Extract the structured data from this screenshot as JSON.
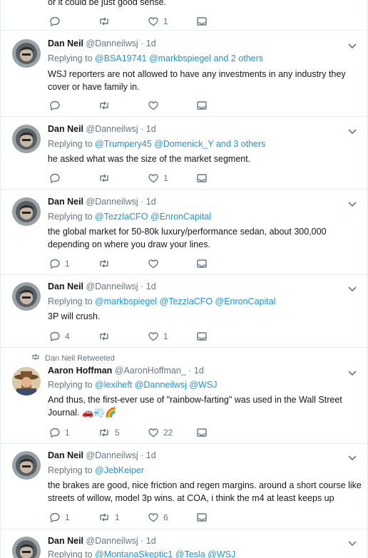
{
  "top_partial": {
    "text": "or it could be just good sense.",
    "like_count": "1"
  },
  "retweet_banner": "Dan Neil Retweeted",
  "tweets": [
    {
      "name": "Dan Neil",
      "handle": "@Danneilwsj",
      "time": "1d",
      "replying_prefix": "Replying to",
      "replying_mentions": "@BSA19741 @markbspiegel",
      "replying_suffix": "and 2 others",
      "text": "WSJ reporters are not allowed to have any investments in any industry they cover or have family in.",
      "reply_count": "",
      "retweet_count": "",
      "like_count": ""
    },
    {
      "name": "Dan Neil",
      "handle": "@Danneilwsj",
      "time": "1d",
      "replying_prefix": "Replying to",
      "replying_mentions": "@Trumpery45 @Domenick_Y",
      "replying_suffix": "and 3 others",
      "text": "he asked what was the size of the market segment.",
      "reply_count": "",
      "retweet_count": "",
      "like_count": "1"
    },
    {
      "name": "Dan Neil",
      "handle": "@Danneilwsj",
      "time": "1d",
      "replying_prefix": "Replying to",
      "replying_mentions": "@TezzlaCFO @EnronCapital",
      "replying_suffix": "",
      "text": "the global market for 50-80k luxury/performance sedan, about 300,000 depending on where you draw your lines.",
      "reply_count": "1",
      "retweet_count": "",
      "like_count": ""
    },
    {
      "name": "Dan Neil",
      "handle": "@Danneilwsj",
      "time": "1d",
      "replying_prefix": "Replying to",
      "replying_mentions": "@markbspiegel @TezzlaCFO @EnronCapital",
      "replying_suffix": "",
      "text": "3P will crush.",
      "reply_count": "4",
      "retweet_count": "",
      "like_count": "1"
    },
    {
      "name": "Aaron Hoffman",
      "handle": "@AaronHoffman_",
      "time": "1d",
      "replying_prefix": "Replying to",
      "replying_mentions": "@lexiheft @Danneilwsj @WSJ",
      "replying_suffix": "",
      "text": "And thus, the first-ever use of \"rainbow-farting\" was used in the Wall Street Journal.",
      "emoji": "🚗💨🌈",
      "reply_count": "1",
      "retweet_count": "5",
      "like_count": "22"
    },
    {
      "name": "Dan Neil",
      "handle": "@Danneilwsj",
      "time": "1d",
      "replying_prefix": "Replying to",
      "replying_mentions": "@JebKeiper",
      "replying_suffix": "",
      "text": "the brakes are good, nice friction and regen margins. around a short course like streets of willow, model 3p wins. at COA, i think the m4 at least keeps up",
      "reply_count": "1",
      "retweet_count": "1",
      "like_count": "6"
    },
    {
      "name": "Dan Neil",
      "handle": "@Danneilwsj",
      "time": "1d",
      "replying_prefix": "Replying to",
      "replying_mentions": "@MontanaSkeptic1 @Tesla @WSJ",
      "replying_suffix": "",
      "text": "",
      "reply_count": "",
      "retweet_count": "",
      "like_count": ""
    }
  ],
  "colors": {
    "link": "#1b95e0",
    "muted": "#657786",
    "border": "#e6ecf0"
  },
  "icons": {
    "reply": "reply-icon",
    "retweet": "retweet-icon",
    "like": "heart-icon",
    "dm": "envelope-icon",
    "more": "chevron-down-icon"
  }
}
